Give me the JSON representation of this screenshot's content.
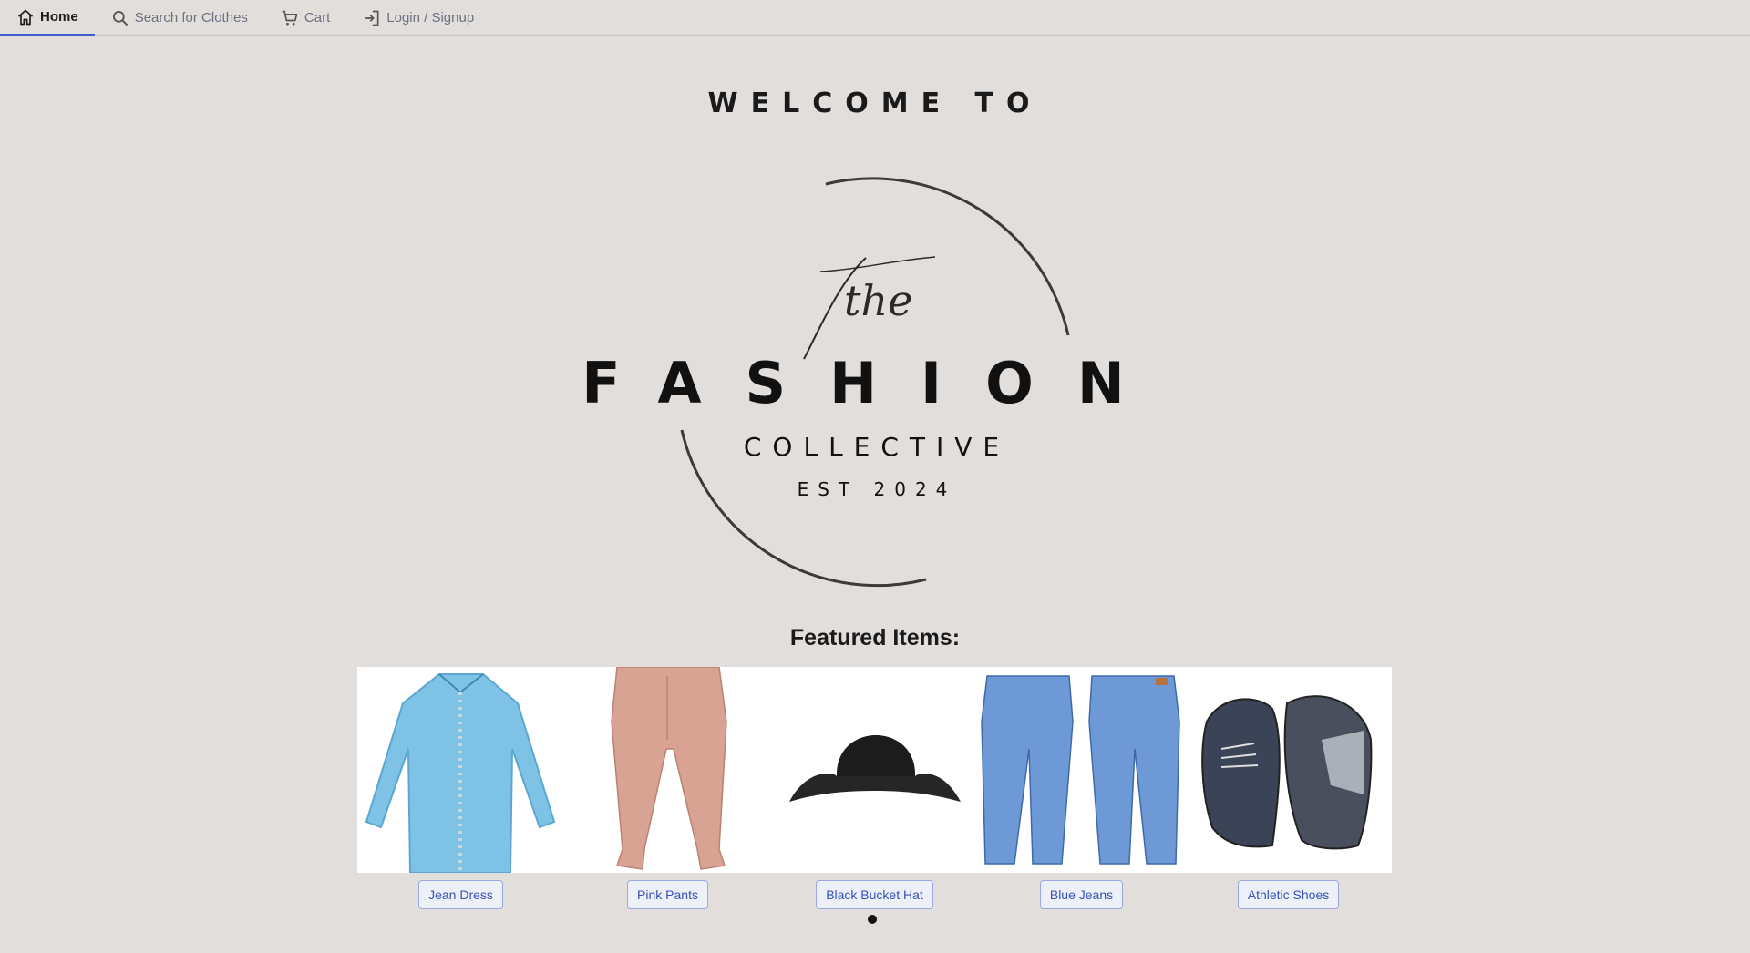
{
  "nav": {
    "items": [
      {
        "label": "Home",
        "icon": "home-icon",
        "active": true
      },
      {
        "label": "Search for Clothes",
        "icon": "search-icon",
        "active": false
      },
      {
        "label": "Cart",
        "icon": "cart-icon",
        "active": false
      },
      {
        "label": "Login / Signup",
        "icon": "login-icon",
        "active": false
      }
    ]
  },
  "hero": {
    "welcome": "WELCOME TO",
    "logo": {
      "script": "the",
      "main": "FASHION",
      "sub": "COLLECTIVE",
      "est": "EST 2024"
    }
  },
  "featured": {
    "title": "Featured Items:",
    "items": [
      {
        "label": "Jean Dress"
      },
      {
        "label": "Pink Pants"
      },
      {
        "label": "Black Bucket Hat"
      },
      {
        "label": "Blue Jeans"
      },
      {
        "label": "Athletic Shoes"
      }
    ]
  },
  "colors": {
    "background": "#e2dedc",
    "accent": "#3f5bd4",
    "button_text": "#3652b8"
  }
}
